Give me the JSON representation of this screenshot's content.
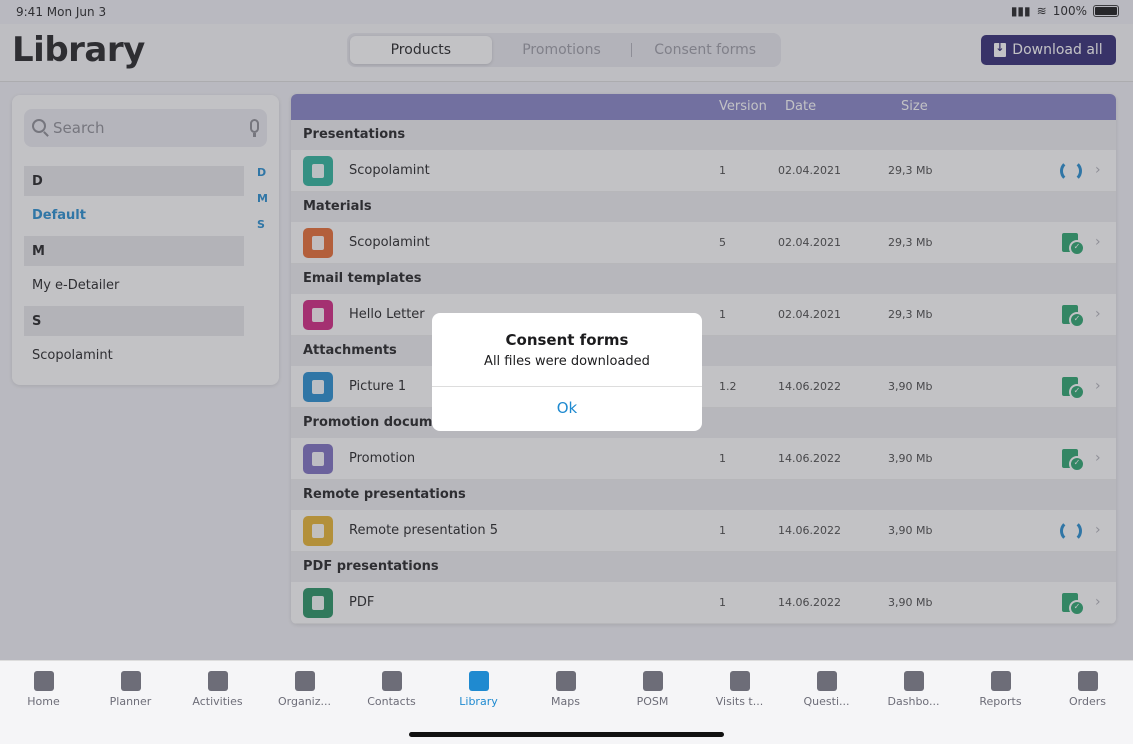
{
  "status_bar": {
    "time": "9:41  Mon Jun 3",
    "battery": "100%"
  },
  "header": {
    "title": "Library",
    "tabs": [
      {
        "label": "Products",
        "active": true
      },
      {
        "label": "Promotions",
        "active": false
      },
      {
        "label": "Consent forms",
        "active": false
      }
    ],
    "download_all_label": "Download all"
  },
  "sidebar": {
    "search_placeholder": "Search",
    "index_letters": [
      "D",
      "M",
      "S"
    ],
    "sections": [
      {
        "letter": "D",
        "items": [
          {
            "label": "Default",
            "active": true
          }
        ]
      },
      {
        "letter": "M",
        "items": [
          {
            "label": "My e-Detailer",
            "active": false
          }
        ]
      },
      {
        "letter": "S",
        "items": [
          {
            "label": "Scopolamint",
            "active": false
          }
        ]
      }
    ]
  },
  "table": {
    "columns": {
      "version": "Version",
      "date": "Date",
      "size": "Size"
    },
    "groups": [
      {
        "label": "Presentations",
        "row": {
          "name": "Scopolamint",
          "version": "1",
          "date": "02.04.2021",
          "size": "29,3 Mb",
          "status": "sync",
          "icon_color": "#27b39a",
          "icon": "presentation-icon"
        }
      },
      {
        "label": "Materials",
        "row": {
          "name": "Scopolamint",
          "version": "5",
          "date": "02.04.2021",
          "size": "29,3 Mb",
          "status": "downloaded",
          "icon_color": "#e8672c",
          "icon": "clipboard-icon"
        }
      },
      {
        "label": "Email templates",
        "row": {
          "name": "Hello Letter",
          "version": "1",
          "date": "02.04.2021",
          "size": "29,3 Mb",
          "status": "downloaded",
          "icon_color": "#d11f7f",
          "icon": "envelope-icon"
        }
      },
      {
        "label": "Attachments",
        "row": {
          "name": "Picture 1",
          "version": "1.2",
          "date": "14.06.2022",
          "size": "3,90 Mb",
          "status": "downloaded",
          "icon_color": "#1f8ad0",
          "icon": "paperclip-icon"
        }
      },
      {
        "label": "Promotion documents",
        "row": {
          "name": "Promotion",
          "version": "1",
          "date": "14.06.2022",
          "size": "3,90 Mb",
          "status": "downloaded",
          "icon_color": "#7a6cc1",
          "icon": "document-icon"
        }
      },
      {
        "label": "Remote presentations",
        "row": {
          "name": "Remote presentation 5",
          "version": "1",
          "date": "14.06.2022",
          "size": "3,90 Mb",
          "status": "sync",
          "icon_color": "#e8b32a",
          "icon": "video-icon"
        }
      },
      {
        "label": "PDF presentations",
        "row": {
          "name": "PDF",
          "version": "1",
          "date": "14.06.2022",
          "size": "3,90 Mb",
          "status": "downloaded",
          "icon_color": "#1f8f5f",
          "icon": "pdf-icon"
        }
      }
    ]
  },
  "dialog": {
    "title": "Consent forms",
    "message": "All files were downloaded",
    "ok_label": "Ok"
  },
  "tabbar": {
    "items": [
      {
        "label": "Home",
        "icon": "home-icon",
        "active": false
      },
      {
        "label": "Planner",
        "icon": "calendar-icon",
        "active": false
      },
      {
        "label": "Activities",
        "icon": "briefcase-icon",
        "active": false
      },
      {
        "label": "Organiz...",
        "icon": "building-icon",
        "active": false
      },
      {
        "label": "Contacts",
        "icon": "contacts-icon",
        "active": false
      },
      {
        "label": "Library",
        "icon": "book-icon",
        "active": true
      },
      {
        "label": "Maps",
        "icon": "map-pin-icon",
        "active": false
      },
      {
        "label": "POSM",
        "icon": "posm-icon",
        "active": false
      },
      {
        "label": "Visits t...",
        "icon": "visits-icon",
        "active": false
      },
      {
        "label": "Questi...",
        "icon": "questionnaire-icon",
        "active": false
      },
      {
        "label": "Dashbo...",
        "icon": "pie-chart-icon",
        "active": false
      },
      {
        "label": "Reports",
        "icon": "bar-chart-icon",
        "active": false
      },
      {
        "label": "Orders",
        "icon": "checklist-icon",
        "active": false
      }
    ]
  },
  "colors": {
    "accent": "#1f8ad0",
    "header_bar": "#8481c6",
    "primary_button": "#2c2470"
  }
}
